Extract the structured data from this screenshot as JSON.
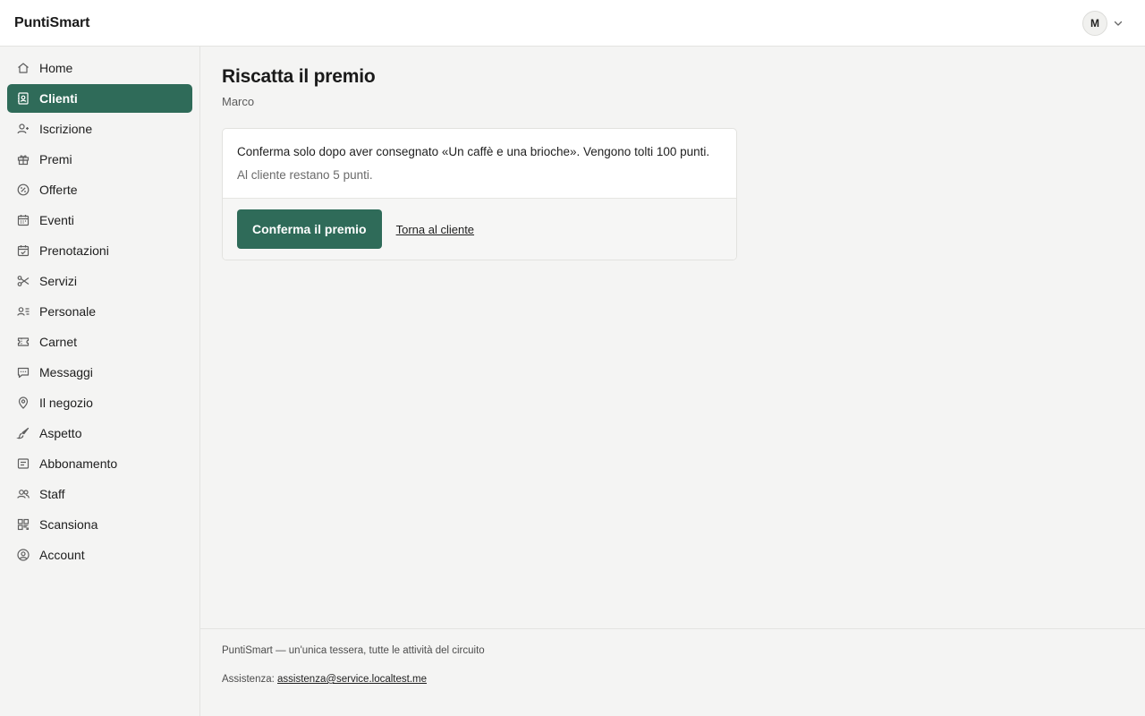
{
  "app": {
    "brand": "PuntiSmart"
  },
  "user": {
    "initial": "M"
  },
  "sidebar": {
    "items": [
      {
        "label": "Home",
        "icon": "home-icon"
      },
      {
        "label": "Clienti",
        "icon": "contact-card-icon",
        "active": true
      },
      {
        "label": "Iscrizione",
        "icon": "user-add-icon"
      },
      {
        "label": "Premi",
        "icon": "gift-icon"
      },
      {
        "label": "Offerte",
        "icon": "percent-badge-icon"
      },
      {
        "label": "Eventi",
        "icon": "calendar-icon"
      },
      {
        "label": "Prenotazioni",
        "icon": "calendar-check-icon"
      },
      {
        "label": "Servizi",
        "icon": "scissors-icon"
      },
      {
        "label": "Personale",
        "icon": "user-list-icon"
      },
      {
        "label": "Carnet",
        "icon": "ticket-icon"
      },
      {
        "label": "Messaggi",
        "icon": "chat-icon"
      },
      {
        "label": "Il negozio",
        "icon": "map-pin-icon"
      },
      {
        "label": "Aspetto",
        "icon": "brush-icon"
      },
      {
        "label": "Abbonamento",
        "icon": "receipt-icon"
      },
      {
        "label": "Staff",
        "icon": "users-icon"
      },
      {
        "label": "Scansiona",
        "icon": "qr-code-icon"
      },
      {
        "label": "Account",
        "icon": "user-circle-icon"
      }
    ]
  },
  "main": {
    "title": "Riscatta il premio",
    "subtitle": "Marco",
    "card": {
      "message": "Conferma solo dopo aver consegnato «Un caffè e una brioche». Vengono tolti 100 punti.",
      "remaining": "Al cliente restano 5 punti.",
      "confirm_label": "Conferma il premio",
      "back_label": "Torna al cliente"
    }
  },
  "footer": {
    "tagline": "PuntiSmart — un'unica tessera, tutte le attività del circuito",
    "support_label": "Assistenza:",
    "support_email": "assistenza@service.localtest.me"
  },
  "colors": {
    "accent": "#2f6b59",
    "background": "#f4f4f3"
  }
}
